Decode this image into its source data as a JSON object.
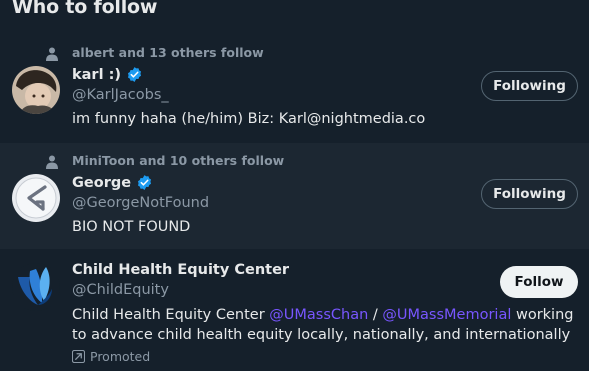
{
  "section": {
    "title": "Who to follow"
  },
  "accounts": [
    {
      "social_context": "albert and 13 others follow",
      "name": "karl :)",
      "handle": "@KarlJacobs_",
      "bio": "im funny haha (he/him) Biz: Karl@nightmedia.co",
      "button_label": "Following",
      "verified": true
    },
    {
      "social_context": "MiniToon and 10 others follow",
      "name": "George",
      "handle": "@GeorgeNotFound",
      "bio": "BIO NOT FOUND",
      "button_label": "Following",
      "verified": true
    },
    {
      "name": "Child Health Equity Center",
      "handle": "@ChildEquity",
      "bio_parts": {
        "prefix": "Child Health Equity Center ",
        "mention1": "@UMassChan",
        "separator": " / ",
        "mention2": "@UMassMemorial",
        "suffix": " working to advance child health equity locally, nationally, and internationally"
      },
      "button_label": "Follow",
      "promoted_label": "Promoted"
    }
  ],
  "colors": {
    "background": "#15202b",
    "hover_background": "#1c2732",
    "verified_badge": "#1d9bf0",
    "mention": "#7856ff",
    "secondary_text": "#8b98a5"
  },
  "icons": {
    "social": "person-icon",
    "verified": "verified-badge-icon",
    "promoted": "promoted-icon"
  }
}
